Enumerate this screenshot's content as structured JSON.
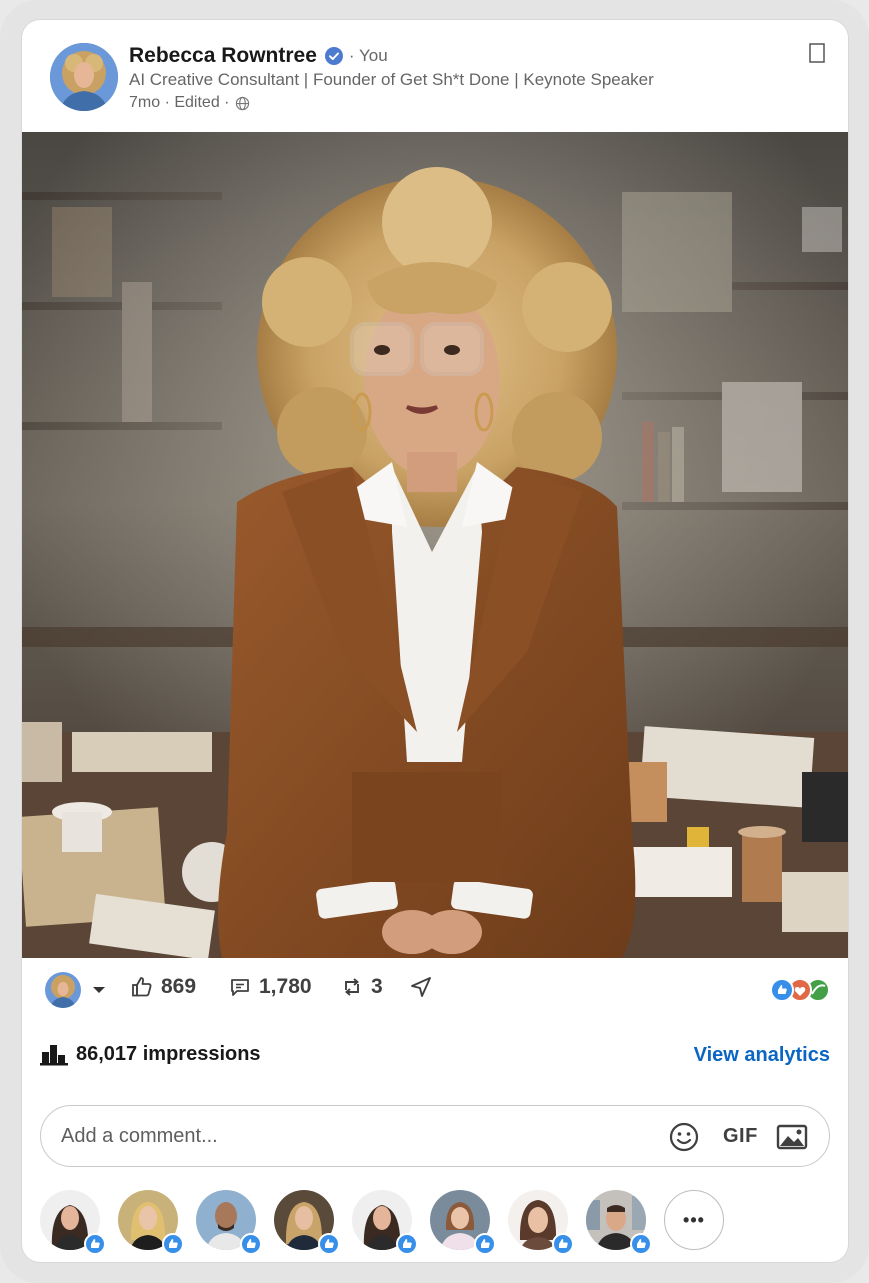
{
  "post": {
    "author_name": "Rebecca Rowntree",
    "you_label": "· You",
    "headline": "AI Creative Consultant | Founder of Get Sh*t Done | Keynote Speaker",
    "meta": "7mo · Edited ·",
    "image_alt": "Woman with curly blonde hair and glasses in a brown corduroy suit sitting on a cluttered desk"
  },
  "actions": {
    "likes": "869",
    "comments": "1,780",
    "reposts": "3"
  },
  "impressions": {
    "label": "86,017 impressions",
    "analytics_link": "View analytics"
  },
  "comment_box": {
    "placeholder": "Add a comment...",
    "gif_label": "GIF"
  },
  "more_label": "•••",
  "colors": {
    "accent": "#0a66c2",
    "verified": "#4d7bd0"
  }
}
